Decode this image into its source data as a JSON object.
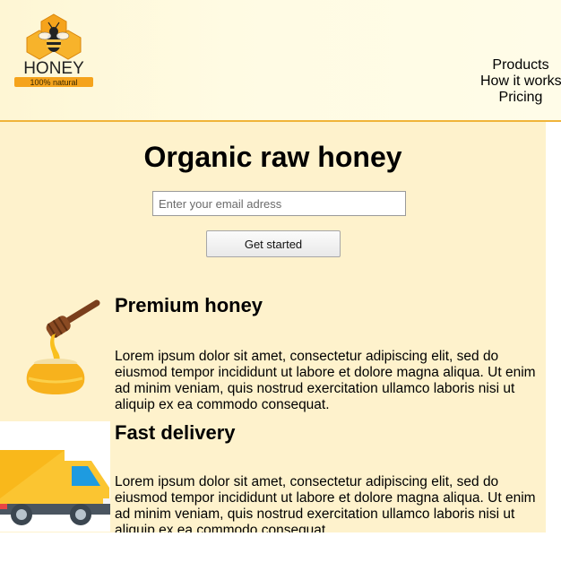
{
  "header": {
    "logo": {
      "word": "HONEY",
      "tagline": "100% natural",
      "icon": "bee-honeycomb-logo"
    },
    "nav": [
      {
        "label": "Products"
      },
      {
        "label": "How it works"
      },
      {
        "label": "Pricing"
      }
    ]
  },
  "hero": {
    "title": "Organic raw honey",
    "email_placeholder": "Enter your email adress",
    "cta_label": "Get started"
  },
  "features": [
    {
      "icon": "honey-pot-dipper-icon",
      "title": "Premium honey",
      "text": "Lorem ipsum dolor sit amet, consectetur adipiscing elit, sed do eiusmod tempor incididunt ut labore et dolore magna aliqua. Ut enim ad minim veniam, quis nostrud exercitation ullamco laboris nisi ut aliquip ex ea commodo consequat."
    },
    {
      "icon": "delivery-truck-icon",
      "title": "Fast delivery",
      "text": "Lorem ipsum dolor sit amet, consectetur adipiscing elit, sed do eiusmod tempor incididunt ut labore et dolore magna aliqua. Ut enim ad minim veniam, quis nostrud exercitation ullamco laboris nisi ut aliquip ex ea commodo consequat."
    }
  ],
  "colors": {
    "header_bg": "#fffbe3",
    "header_border": "#f0b43a",
    "main_bg": "#fef2cc",
    "honey": "#f7b21d",
    "truck_yellow": "#fbc531",
    "truck_blue": "#1e9be0"
  }
}
